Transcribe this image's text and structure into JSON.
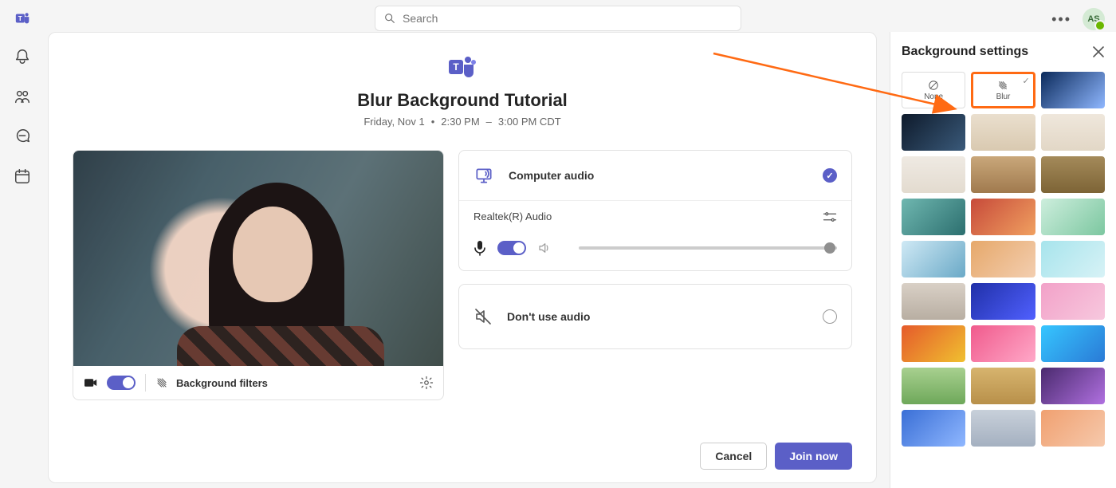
{
  "topbar": {
    "search_placeholder": "Search",
    "avatar_initials": "AS"
  },
  "meeting": {
    "title": "Blur Background Tutorial",
    "date": "Friday, Nov 1",
    "time_start": "2:30 PM",
    "time_end": "3:00 PM CDT",
    "background_filters_label": "Background filters"
  },
  "audio": {
    "computer_audio_label": "Computer audio",
    "device_name": "Realtek(R) Audio",
    "dont_use_label": "Don't use audio",
    "selected": "computer"
  },
  "actions": {
    "cancel": "Cancel",
    "join": "Join now"
  },
  "panel": {
    "title": "Background settings",
    "none_label": "None",
    "blur_label": "Blur",
    "selected": "blur"
  }
}
